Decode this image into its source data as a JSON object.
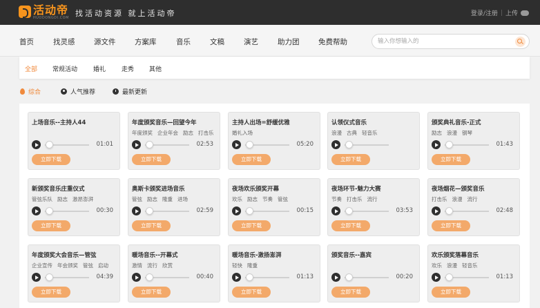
{
  "header": {
    "logo_title": "活动帝",
    "logo_sub": "HUODONGDI.COM",
    "slogan": "找活动资源 就上活动帝",
    "login": "登录/注册",
    "upload": "上传"
  },
  "nav": {
    "items": [
      "首页",
      "找灵感",
      "源文件",
      "方案库",
      "音乐",
      "文稿",
      "演艺",
      "助力团",
      "免费帮助"
    ],
    "search_placeholder": "输入你想输入的"
  },
  "categories": [
    "全部",
    "常规活动",
    "婚礼",
    "走秀",
    "其他"
  ],
  "sort": [
    "综合",
    "人气推荐",
    "最新更新"
  ],
  "download_label": "立即下载",
  "cards": [
    {
      "title": "上场音乐--主持人44",
      "tags": [],
      "time": "01:01"
    },
    {
      "title": "年度颁奖音乐—回望今年",
      "tags": [
        "年度颁奖",
        "企业年会",
        "励志",
        "打击乐"
      ],
      "time": "02:53"
    },
    {
      "title": "主持人出场=舒缓优雅",
      "tags": [
        "婚礼入场"
      ],
      "time": "05:20"
    },
    {
      "title": "认领仪式音乐",
      "tags": [
        "浪漫",
        "古典",
        "轻音乐"
      ],
      "time": ""
    },
    {
      "title": "颁奖典礼音乐-正式",
      "tags": [
        "励志",
        "浪漫",
        "钢琴"
      ],
      "time": "01:43"
    },
    {
      "title": "新颁奖音乐庄重仪式",
      "tags": [
        "管弦乐队",
        "励志",
        "激昂澎湃"
      ],
      "time": "00:30"
    },
    {
      "title": "奥斯卡颁奖进场音乐",
      "tags": [
        "管弦",
        "励志",
        "隆重",
        "进场"
      ],
      "time": "02:59"
    },
    {
      "title": "夜场欢乐颁奖开幕",
      "tags": [
        "欢乐",
        "励志",
        "节奏",
        "管弦"
      ],
      "time": "00:15"
    },
    {
      "title": "夜场环节-魅力大赛",
      "tags": [
        "节奏",
        "打击乐",
        "流行"
      ],
      "time": "03:53"
    },
    {
      "title": "夜场烟花—颁奖音乐",
      "tags": [
        "打击乐",
        "浪漫",
        "流行"
      ],
      "time": "02:48"
    },
    {
      "title": "年度颁奖大会音乐—管弦",
      "tags": [
        "企业宣传",
        "年会颁奖",
        "管弦",
        "启动"
      ],
      "time": "04:39"
    },
    {
      "title": "暖场音乐--开幕式",
      "tags": [
        "激情",
        "流行",
        "欣赏"
      ],
      "time": "00:40"
    },
    {
      "title": "暖场音乐-激扬澎湃",
      "tags": [
        "轻快",
        "隆重"
      ],
      "time": "01:13"
    },
    {
      "title": "颁奖音乐--嘉宾",
      "tags": [],
      "time": "00:20"
    },
    {
      "title": "欢乐颁奖落幕音乐",
      "tags": [
        "欢乐",
        "浪漫",
        "轻音乐"
      ],
      "time": "01:13"
    }
  ]
}
